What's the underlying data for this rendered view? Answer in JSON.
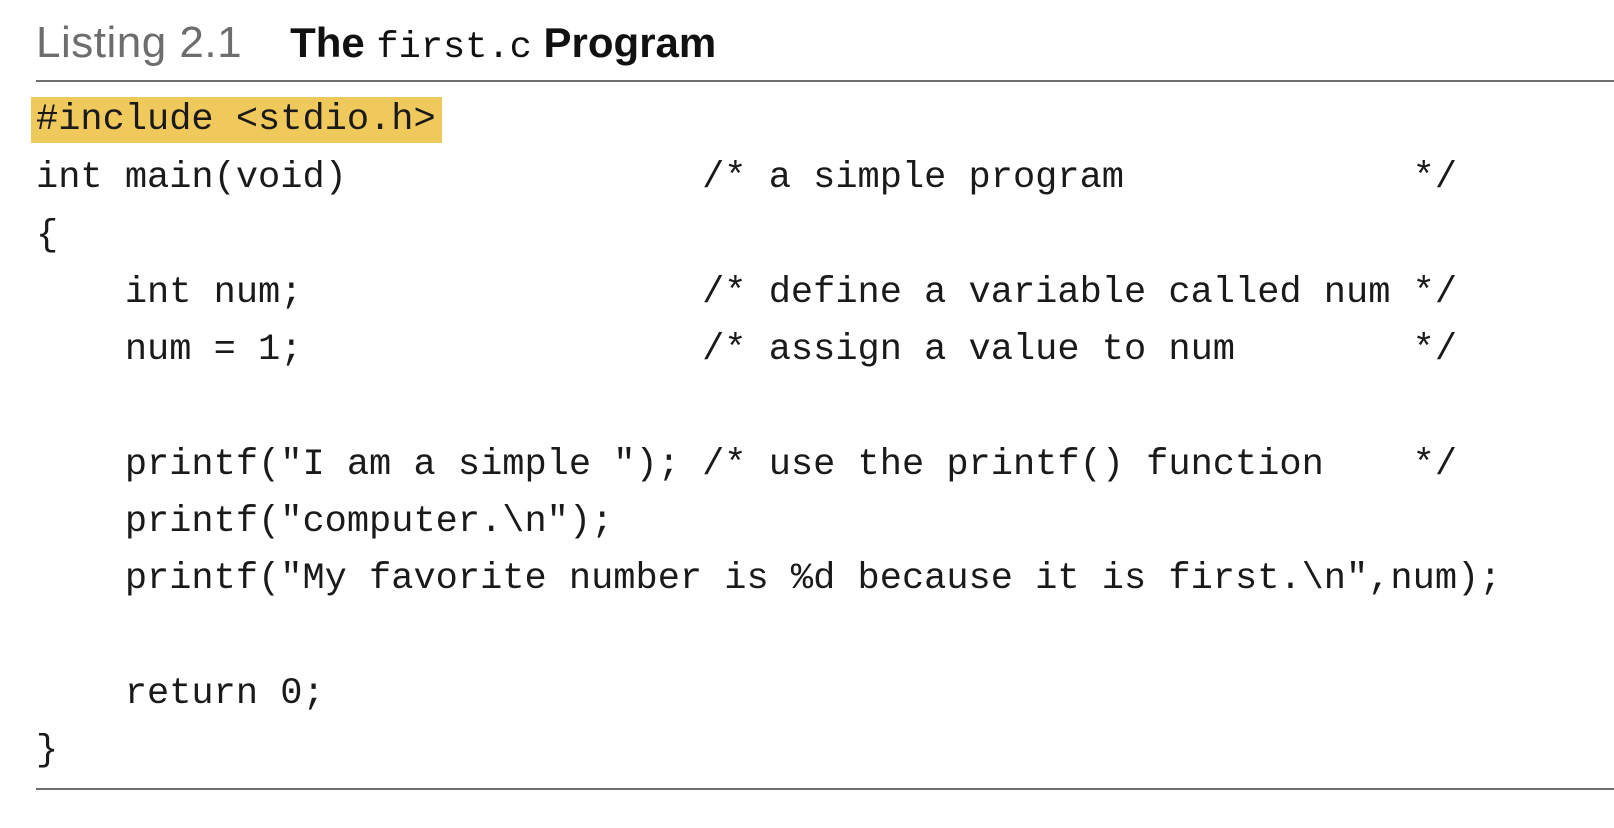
{
  "listing": {
    "label": "Listing 2.1",
    "title_prefix": "The",
    "title_code": "first.c",
    "title_suffix": "Program",
    "highlight_color": "#f0c95c",
    "lines": [
      "#include <stdio.h>",
      "int main(void)                /* a simple program             */",
      "{",
      "    int num;                  /* define a variable called num */",
      "    num = 1;                  /* assign a value to num        */",
      "",
      "    printf(\"I am a simple \"); /* use the printf() function    */",
      "    printf(\"computer.\\n\");",
      "    printf(\"My favorite number is %d because it is first.\\n\",num);",
      "",
      "    return 0;",
      "}"
    ]
  }
}
